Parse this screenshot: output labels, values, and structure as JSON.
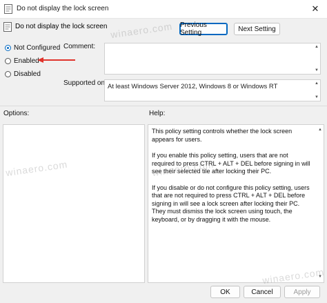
{
  "window": {
    "title": "Do not display the lock screen",
    "close_glyph": "✕"
  },
  "header": {
    "policy_name": "Do not display the lock screen"
  },
  "nav": {
    "previous_label": "Previous Setting",
    "next_label": "Next Setting"
  },
  "state": {
    "options": [
      {
        "label": "Not Configured",
        "checked": true
      },
      {
        "label": "Enabled",
        "checked": false
      },
      {
        "label": "Disabled",
        "checked": false
      }
    ]
  },
  "comment": {
    "label": "Comment:",
    "value": ""
  },
  "supported": {
    "label": "Supported on:",
    "value": "At least Windows Server 2012, Windows 8 or Windows RT"
  },
  "panes": {
    "options_label": "Options:",
    "help_label": "Help:"
  },
  "help_text": {
    "p1": "This policy setting controls whether the lock screen appears for users.",
    "p2": "If you enable this policy setting, users that are not required to press CTRL + ALT + DEL before signing in will see their selected tile after locking their PC.",
    "p3": "If you disable or do not configure this policy setting, users that are not required to press CTRL + ALT + DEL before signing in will see a lock screen after locking their PC. They must dismiss the lock screen using touch, the keyboard, or by dragging it with the mouse."
  },
  "footer": {
    "ok_label": "OK",
    "cancel_label": "Cancel",
    "apply_label": "Apply"
  },
  "watermark": "winaero.com",
  "colors": {
    "accent": "#0067c0",
    "annotation_arrow": "#e0332b"
  }
}
